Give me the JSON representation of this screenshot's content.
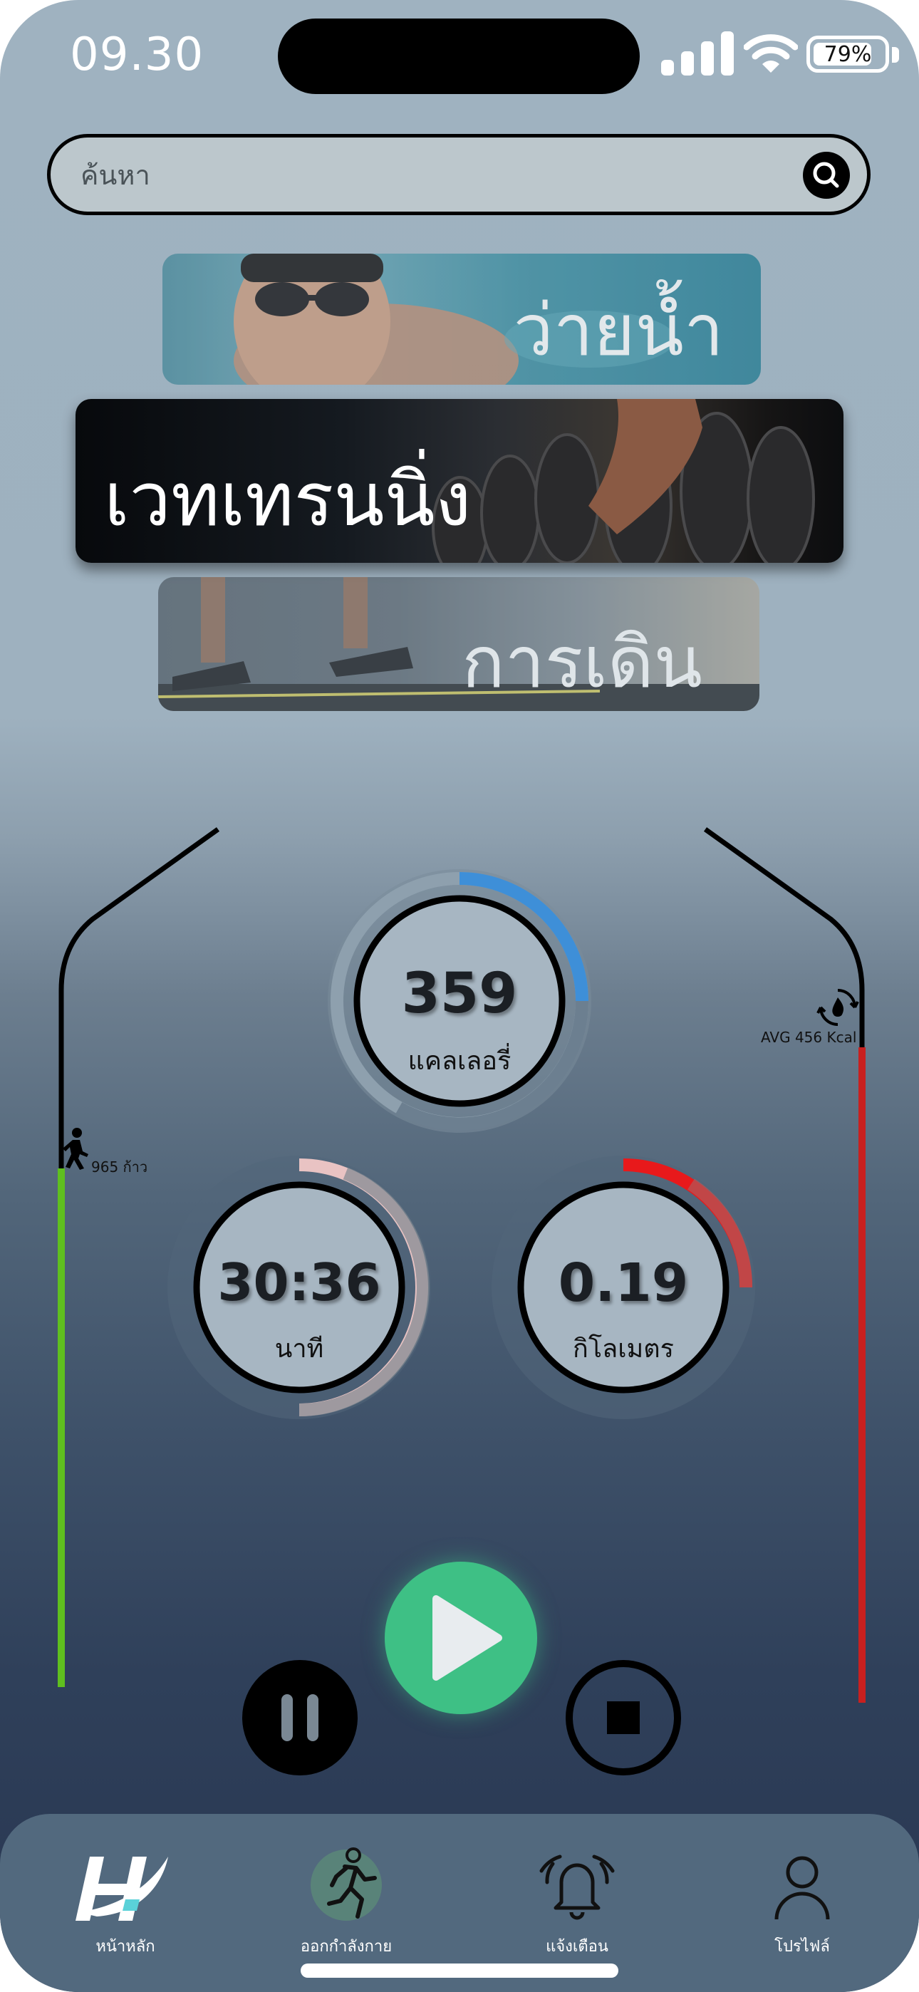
{
  "status_bar": {
    "time": "09.30",
    "battery": "79%"
  },
  "search": {
    "placeholder": "ค้นหา",
    "value": ""
  },
  "activities": [
    {
      "label": "ว่ายน้ำ"
    },
    {
      "label": "เวทเทรนนิ่ง"
    },
    {
      "label": "การเดิน"
    }
  ],
  "left_meter": {
    "steps_text": "965 ก้าว",
    "color": "#5fbf1f"
  },
  "right_meter": {
    "avg_text": "AVG 456 Kcal",
    "color": "#c8201f"
  },
  "stats": {
    "calories": {
      "value": "359",
      "unit": "แคลเลอรี่",
      "color": "#3e8fd8"
    },
    "time": {
      "value": "30:36",
      "unit": "นาที",
      "color": "#e9c3c3"
    },
    "distance": {
      "value": "0.19",
      "unit": "กิโลเมตร",
      "color": "#e8191b"
    }
  },
  "controls": {
    "play": "play-icon",
    "pause": "pause-icon",
    "stop": "stop-icon",
    "play_color": "#3ec085"
  },
  "nav": {
    "items": [
      {
        "label": "หน้าหลัก",
        "icon": "home-logo-icon"
      },
      {
        "label": "ออกกำลังกาย",
        "icon": "runner-icon"
      },
      {
        "label": "แจ้งเตือน",
        "icon": "bell-icon"
      },
      {
        "label": "โปรไฟล์",
        "icon": "profile-icon"
      }
    ]
  }
}
